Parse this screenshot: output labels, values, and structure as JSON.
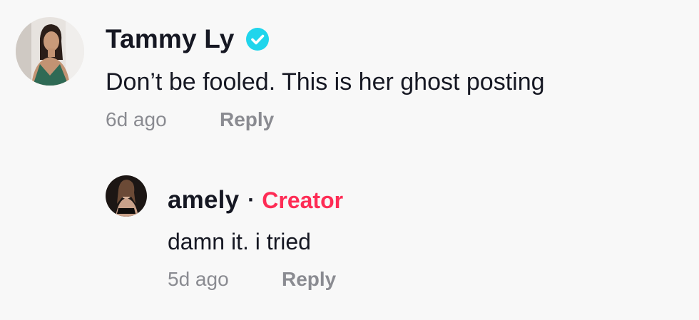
{
  "comments": [
    {
      "username": "Tammy Ly",
      "verified": true,
      "text": "Don’t be fooled. This is her ghost posting",
      "time": "6d ago",
      "reply_label": "Reply"
    },
    {
      "username": "amely",
      "separator": "·",
      "badge": "Creator",
      "text": "damn it. i tried",
      "time": "5d ago",
      "reply_label": "Reply"
    }
  ],
  "colors": {
    "verified_badge": "#20d5ec",
    "creator_badge": "#fe2c55",
    "muted_text": "#8a8b91",
    "primary_text": "#161823"
  }
}
